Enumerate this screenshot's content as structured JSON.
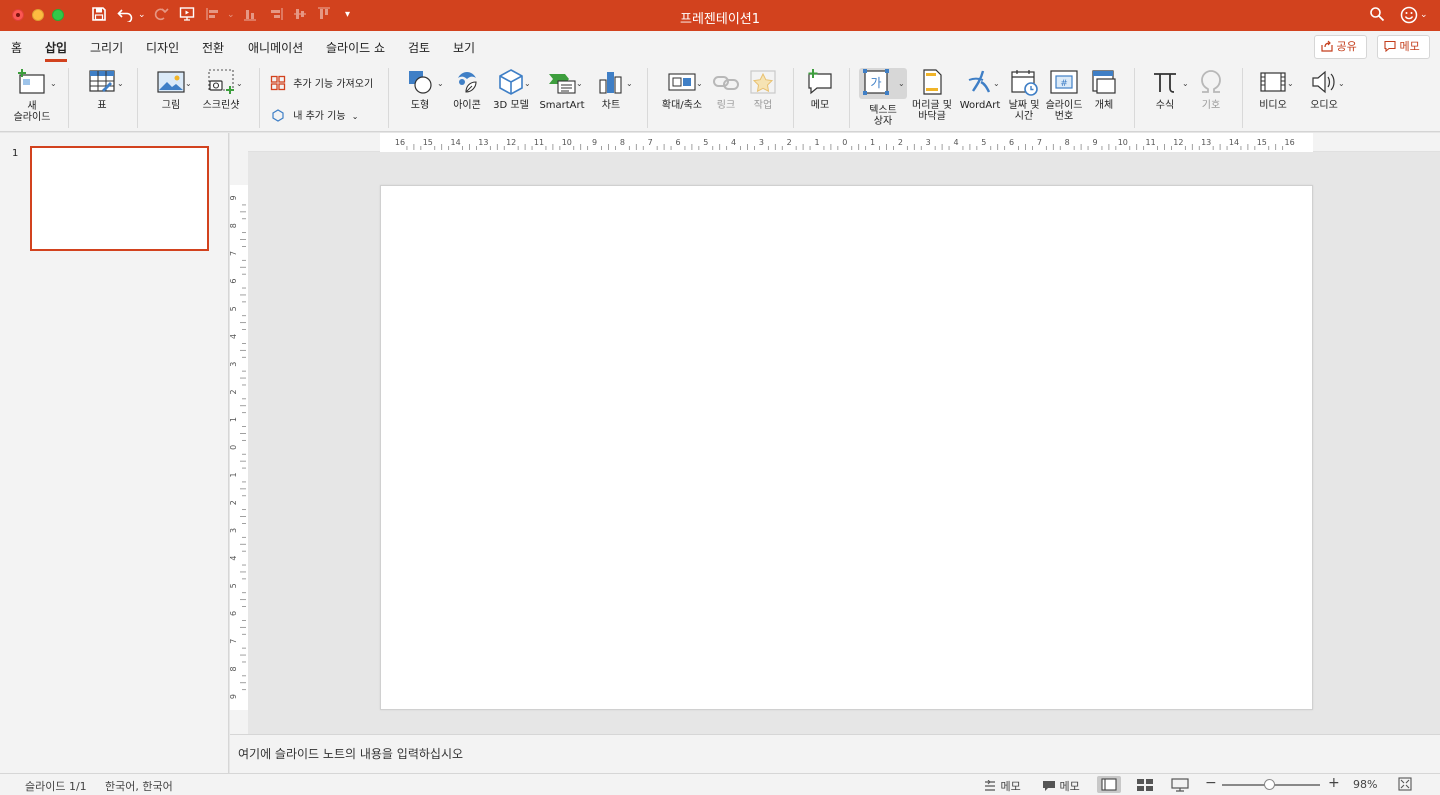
{
  "window": {
    "title": "프레젠테이션1"
  },
  "tabs": [
    "홈",
    "삽입",
    "그리기",
    "디자인",
    "전환",
    "애니메이션",
    "슬라이드 쇼",
    "검토",
    "보기"
  ],
  "active_tab": "삽입",
  "top_buttons": {
    "share": "공유",
    "comments": "메모"
  },
  "ribbon": {
    "new_slide": "새\n슬라이드",
    "table": "표",
    "picture": "그림",
    "screenshot": "스크린샷",
    "get_addins": "추가 기능 가져오기",
    "my_addins": "내 추가 기능",
    "shapes": "도형",
    "icons": "아이콘",
    "models_3d": "3D 모델",
    "smartart": "SmartArt",
    "chart": "차트",
    "zoom": "확대/축소",
    "link": "링크",
    "action": "작업",
    "comment": "메모",
    "textbox": "텍스트\n상자",
    "header_footer": "머리글 및\n바닥글",
    "wordart": "WordArt",
    "date_time": "날짜 및\n시간",
    "slide_number": "슬라이드\n번호",
    "object": "개체",
    "equation": "수식",
    "symbol": "기호",
    "video": "비디오",
    "audio": "오디오"
  },
  "thumbnails": [
    {
      "number": "1"
    }
  ],
  "ruler": {
    "h_labels": [
      "16",
      "15",
      "14",
      "13",
      "12",
      "11",
      "10",
      "9",
      "8",
      "7",
      "6",
      "5",
      "4",
      "3",
      "2",
      "1",
      "0",
      "1",
      "2",
      "3",
      "4",
      "5",
      "6",
      "7",
      "8",
      "9",
      "10",
      "11",
      "12",
      "13",
      "14",
      "15",
      "16"
    ],
    "v_labels": [
      "9",
      "8",
      "7",
      "6",
      "5",
      "4",
      "3",
      "2",
      "1",
      "0",
      "1",
      "2",
      "3",
      "4",
      "5",
      "6",
      "7",
      "8",
      "9"
    ]
  },
  "notes": {
    "placeholder": "여기에 슬라이드 노트의 내용을 입력하십시오"
  },
  "status": {
    "slide": "슬라이드 1/1",
    "language": "한국어, 한국어",
    "notes": "메모",
    "comments": "메모",
    "zoom": "98%",
    "zoom_level": 0.98
  },
  "colors": {
    "accent": "#d2421e",
    "title_bar": "#d2421e",
    "ribbon_bg": "#f3f3f3",
    "canvas_bg": "#e6e6e6"
  }
}
